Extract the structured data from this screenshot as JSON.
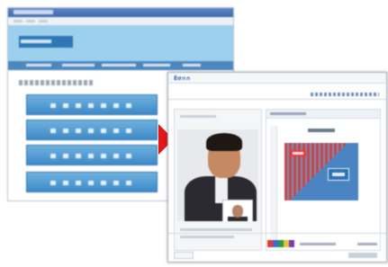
{
  "front_window": {
    "title": "Ѐσ∩∩"
  },
  "colors": {
    "nav_blue": "#4d87be",
    "banner_blue": "#9cd0ee",
    "button_blue": "#3d8ac8",
    "arrow_red": "#e01818",
    "slide_red": "#c5454a",
    "slide_blue": "#4a84c2"
  },
  "icons": [
    "right-arrow-icon",
    "logo-icon"
  ]
}
